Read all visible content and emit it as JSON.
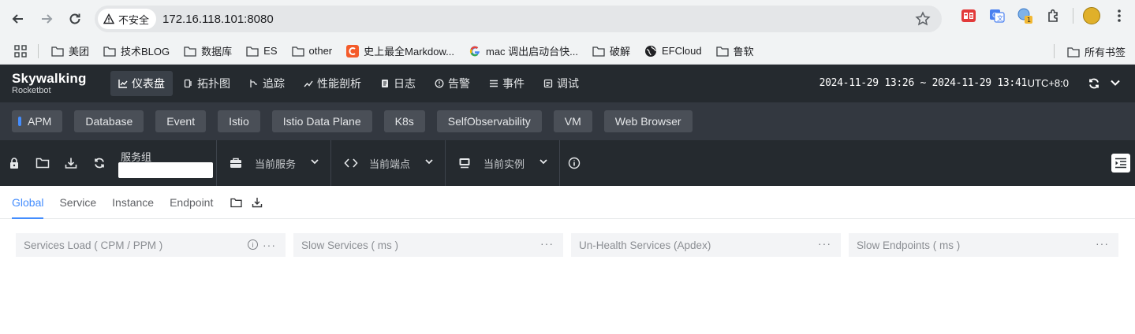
{
  "browser": {
    "security_label": "不安全",
    "url": "172.16.118.101:8080"
  },
  "bookmarks": {
    "items": [
      {
        "label": "美团",
        "icon": "folder-icon"
      },
      {
        "label": "技术BLOG",
        "icon": "folder-icon"
      },
      {
        "label": "数据库",
        "icon": "folder-icon"
      },
      {
        "label": "ES",
        "icon": "folder-icon"
      },
      {
        "label": "other",
        "icon": "folder-icon"
      },
      {
        "label": "史上最全Markdow...",
        "icon": "csdn-icon"
      },
      {
        "label": "mac 调出启动台快...",
        "icon": "google-icon"
      },
      {
        "label": "破解",
        "icon": "folder-icon"
      },
      {
        "label": "EFCloud",
        "icon": "globe-icon"
      },
      {
        "label": "鲁软",
        "icon": "folder-icon"
      }
    ],
    "all_bookmarks_label": "所有书签"
  },
  "app": {
    "logo_main": "Skywalking",
    "logo_sub": "Rocketbot",
    "menu": [
      {
        "label": "仪表盘",
        "icon": "dashboard-icon",
        "active": true
      },
      {
        "label": "拓扑图",
        "icon": "topology-icon",
        "active": false
      },
      {
        "label": "追踪",
        "icon": "trace-icon",
        "active": false
      },
      {
        "label": "性能剖析",
        "icon": "profile-icon",
        "active": false
      },
      {
        "label": "日志",
        "icon": "log-icon",
        "active": false
      },
      {
        "label": "告警",
        "icon": "alarm-icon",
        "active": false
      },
      {
        "label": "事件",
        "icon": "event-icon",
        "active": false
      },
      {
        "label": "调试",
        "icon": "debug-icon",
        "active": false
      }
    ],
    "time_range": "2024-11-29 13:26 ~ 2024-11-29 13:41",
    "timezone": "UTC+8:0"
  },
  "layers": [
    {
      "label": "APM",
      "active": true
    },
    {
      "label": "Database"
    },
    {
      "label": "Event"
    },
    {
      "label": "Istio"
    },
    {
      "label": "Istio Data Plane"
    },
    {
      "label": "K8s"
    },
    {
      "label": "SelfObservability"
    },
    {
      "label": "VM"
    },
    {
      "label": "Web Browser"
    }
  ],
  "selectors": {
    "service_group_label": "服务组",
    "service_group_value": "",
    "service_label": "当前服务",
    "endpoint_label": "当前端点",
    "instance_label": "当前实例"
  },
  "dashboard_tabs": [
    {
      "label": "Global",
      "active": true
    },
    {
      "label": "Service"
    },
    {
      "label": "Instance"
    },
    {
      "label": "Endpoint"
    }
  ],
  "widgets": [
    {
      "title": "Services Load ( CPM / PPM )",
      "has_info": true
    },
    {
      "title": "Slow Services ( ms )",
      "has_info": false
    },
    {
      "title": "Un-Health Services (Apdex)",
      "has_info": false
    },
    {
      "title": "Slow Endpoints ( ms )",
      "has_info": false
    }
  ],
  "colors": {
    "accent": "#448dfe",
    "header_bg": "#252a2f",
    "layer_bg": "#333840"
  }
}
